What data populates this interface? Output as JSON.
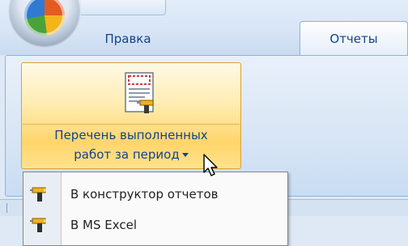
{
  "tabs": {
    "edit_label": "Правка",
    "reports_label": "Отчеты"
  },
  "ribbon": {
    "report_button": {
      "label_line1": "Перечень выполненных",
      "label_line2": "работ за период"
    }
  },
  "dropdown_menu": {
    "items": [
      {
        "label": "В конструктор отчетов",
        "icon": "drill-icon"
      },
      {
        "label": "В MS Excel",
        "icon": "drill-icon"
      }
    ]
  },
  "colors": {
    "tab_text": "#15428b",
    "button_hover": "#ffd56b",
    "ribbon_background": "#dbe7f6"
  }
}
